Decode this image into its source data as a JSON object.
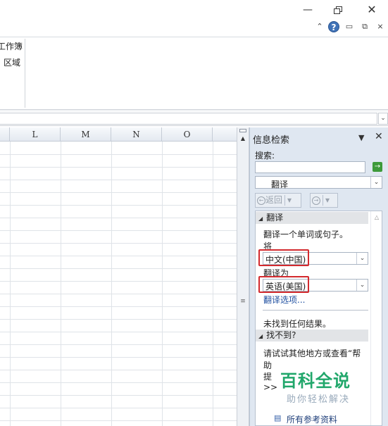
{
  "window": {
    "minimize_glyph": "—",
    "close_glyph": "✕"
  },
  "ribbon": {
    "collapse_glyph": "⌃",
    "help_glyph": "?",
    "mini_min_glyph": "▭",
    "mini_restore_glyph": "⧉",
    "mini_close_glyph": "⨯",
    "cmd_workbook": "工作簿",
    "cmd_region": "区域"
  },
  "formula_bar": {
    "expand_glyph": "⌄"
  },
  "sheet": {
    "columns": [
      "L",
      "M",
      "N",
      "O"
    ]
  },
  "research_pane": {
    "title": "信息检索",
    "dropdown_glyph": "▼",
    "close_glyph": "✕",
    "search_label": "搜索:",
    "search_value": "",
    "go_glyph": "→",
    "service": "翻译",
    "back_label": "返回",
    "nav": {
      "back_icon": "←",
      "forward_icon": "→",
      "menu_glyph": "▾"
    },
    "translate_section": {
      "header": "翻译",
      "desc": "翻译一个单词或句子。",
      "from_label": "将",
      "from_lang": "中文(中国)",
      "to_label": "翻译为",
      "to_lang": "英语(美国)",
      "options_link": "翻译选项..."
    },
    "no_results": "未找到任何结果。",
    "notfound_section": {
      "header": "找不到?",
      "suggest_line1": "请试试其他地方或查看“帮",
      "suggest_line2": "助",
      "suggest_line3": "提",
      "suggest_more": ">>"
    },
    "all_references": "所有参考资料"
  },
  "watermark": {
    "brand": "百科全说",
    "slogan": "助你轻松解决"
  },
  "icons": {
    "go": "arrow-right-icon",
    "collapse": "chevron-up-icon",
    "help": "help-icon",
    "references": "book-icon"
  },
  "colors": {
    "highlight": "#d32a2e",
    "pane_bg": "#dfe7f1",
    "go_button": "#3d9a3a",
    "watermark": "#21a76b",
    "link": "#1f4fa0"
  }
}
